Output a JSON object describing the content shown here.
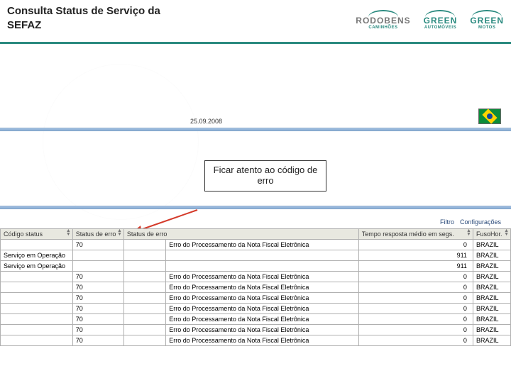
{
  "title": "Consulta Status de Serviço da SEFAZ",
  "logos": [
    {
      "brand": "RODOBENS",
      "sub": "CAMINHÕES",
      "green": false
    },
    {
      "brand": "GREEN",
      "sub": "AUTOMÓVEIS",
      "green": true
    },
    {
      "brand": "GREEN",
      "sub": "MOTOS",
      "green": true
    }
  ],
  "date": "25.09.2008",
  "callout": "Ficar atento ao código de erro",
  "toolbar": {
    "filtro": "Filtro",
    "config": "Configurações"
  },
  "columns": {
    "codigo_status": "Código status",
    "status_erro": "Status de erro",
    "status_erro2": "Status de erro",
    "tempo": "Tempo resposta médio em segs.",
    "fuso": "FusoHor."
  },
  "rows": [
    {
      "codigo": "",
      "err": "70",
      "desc": "Erro do Processamento da Nota Fiscal Eletrônica",
      "tempo": "0",
      "fuso": "BRAZIL"
    },
    {
      "codigo": "Serviço em Operação",
      "err": "",
      "desc": "",
      "tempo": "911",
      "fuso": "BRAZIL"
    },
    {
      "codigo": "Serviço em Operação",
      "err": "",
      "desc": "",
      "tempo": "911",
      "fuso": "BRAZIL"
    },
    {
      "codigo": "",
      "err": "70",
      "desc": "Erro do Processamento da Nota Fiscal Eletrônica",
      "tempo": "0",
      "fuso": "BRAZIL"
    },
    {
      "codigo": "",
      "err": "70",
      "desc": "Erro do Processamento da Nota Fiscal Eletrônica",
      "tempo": "0",
      "fuso": "BRAZIL"
    },
    {
      "codigo": "",
      "err": "70",
      "desc": "Erro do Processamento da Nota Fiscal Eletrônica",
      "tempo": "0",
      "fuso": "BRAZIL"
    },
    {
      "codigo": "",
      "err": "70",
      "desc": "Erro do Processamento da Nota Fiscal Eletrônica",
      "tempo": "0",
      "fuso": "BRAZIL"
    },
    {
      "codigo": "",
      "err": "70",
      "desc": "Erro do Processamento da Nota Fiscal Eletrônica",
      "tempo": "0",
      "fuso": "BRAZIL"
    },
    {
      "codigo": "",
      "err": "70",
      "desc": "Erro do Processamento da Nota Fiscal Eletrônica",
      "tempo": "0",
      "fuso": "BRAZIL"
    },
    {
      "codigo": "",
      "err": "70",
      "desc": "Erro do Processamento da Nota Fiscal Eletrônica",
      "tempo": "0",
      "fuso": "BRAZIL"
    }
  ]
}
